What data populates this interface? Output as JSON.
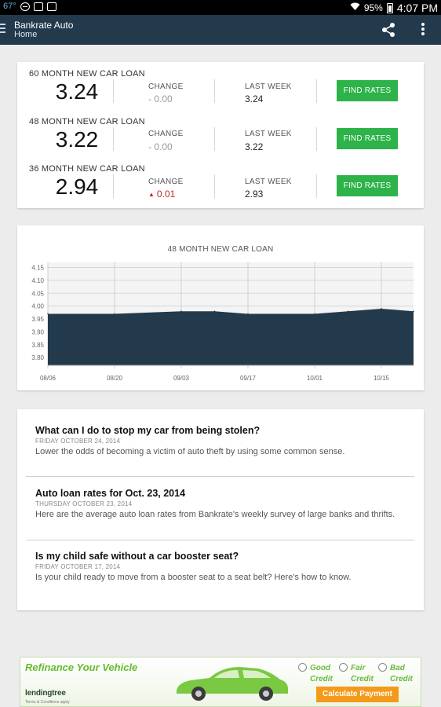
{
  "status_bar": {
    "temperature": "67°",
    "battery": "95%",
    "time": "4:07 PM"
  },
  "app_bar": {
    "title": "Bankrate Auto",
    "subtitle": "Home"
  },
  "rates": {
    "change_label": "CHANGE",
    "last_week_label": "LAST WEEK",
    "button_label": "FIND RATES",
    "items": [
      {
        "name": "60 MONTH NEW CAR LOAN",
        "value": "3.24",
        "change": "- 0.00",
        "last_week": "3.24"
      },
      {
        "name": "48 MONTH NEW CAR LOAN",
        "value": "3.22",
        "change": "- 0.00",
        "last_week": "3.22"
      },
      {
        "name": "36 MONTH NEW CAR LOAN",
        "value": "2.94",
        "change": "0.01",
        "change_direction": "up",
        "last_week": "2.93"
      }
    ]
  },
  "chart_data": {
    "type": "area",
    "title": "48 MONTH NEW CAR LOAN",
    "x_ticks": [
      "08/06",
      "08/20",
      "09/03",
      "09/17",
      "10/01",
      "10/15"
    ],
    "y_ticks": [
      3.8,
      3.85,
      3.9,
      3.95,
      4.0,
      4.05,
      4.1,
      4.15
    ],
    "ylim": [
      3.77,
      4.17
    ],
    "x": [
      "08/06",
      "08/20",
      "09/03",
      "09/10",
      "09/17",
      "10/01",
      "10/08",
      "10/15",
      "10/22"
    ],
    "values": [
      3.97,
      3.97,
      3.98,
      3.98,
      3.97,
      3.97,
      3.98,
      3.99,
      3.98
    ],
    "grid": true,
    "color": "#233a4d"
  },
  "news": [
    {
      "title": "What can I do to stop my car from being stolen?",
      "date": "FRIDAY OCTOBER 24, 2014",
      "summary": "Lower the odds of becoming a victim of auto theft by using some common sense."
    },
    {
      "title": "Auto loan rates for Oct. 23, 2014",
      "date": "THURSDAY OCTOBER 23, 2014",
      "summary": "Here are the average auto loan rates from Bankrate's weekly survey of large banks and thrifts."
    },
    {
      "title": "Is my child safe without a car booster seat?",
      "date": "FRIDAY OCTOBER 17, 2014",
      "summary": "Is your child ready to move from a booster seat to a seat belt? Here's how to know."
    }
  ],
  "ad": {
    "title": "Refinance Your Vehicle",
    "logo": "lendingtree",
    "terms": "Terms & Conditions apply",
    "options": [
      {
        "line1": "Good",
        "line2": "Credit"
      },
      {
        "line1": "Fair",
        "line2": "Credit"
      },
      {
        "line1": "Bad",
        "line2": "Credit"
      }
    ],
    "button": "Calculate Payment"
  },
  "colors": {
    "app_bar": "#233a4d",
    "button_green": "#2db34a",
    "change_up": "#c0282d",
    "ad_orange": "#f49a1b",
    "ad_green": "#66bb2f"
  },
  "icons": [
    "menu-icon",
    "share-icon",
    "overflow-menu-icon",
    "wifi-icon",
    "battery-icon"
  ]
}
